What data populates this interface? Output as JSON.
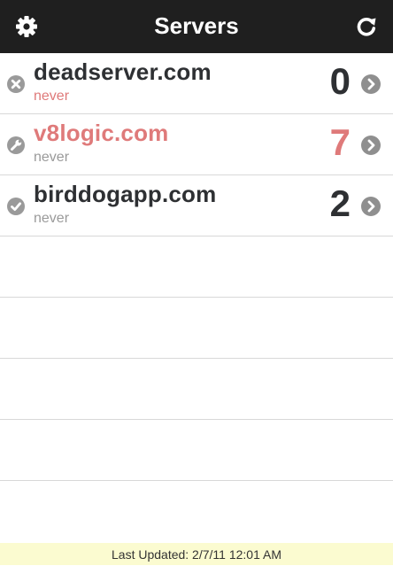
{
  "header": {
    "title": "Servers",
    "settings_icon": "gear-icon",
    "refresh_icon": "refresh-icon"
  },
  "servers": [
    {
      "name": "deadserver.com",
      "last_check": "never",
      "count": "0",
      "status": "down",
      "status_icon": "x-circle-icon"
    },
    {
      "name": "v8logic.com",
      "last_check": "never",
      "count": "7",
      "status": "warning",
      "status_icon": "wrench-icon"
    },
    {
      "name": "birddogapp.com",
      "last_check": "never",
      "count": "2",
      "status": "ok",
      "status_icon": "check-circle-icon"
    }
  ],
  "footer": {
    "last_updated": "Last Updated: 2/7/11 12:01 AM"
  },
  "colors": {
    "navbar": "#1f1f1f",
    "alert": "#df7a7a",
    "text": "#2e3033",
    "muted": "#9a9a9a",
    "footer_bg": "#fbfbd0"
  }
}
